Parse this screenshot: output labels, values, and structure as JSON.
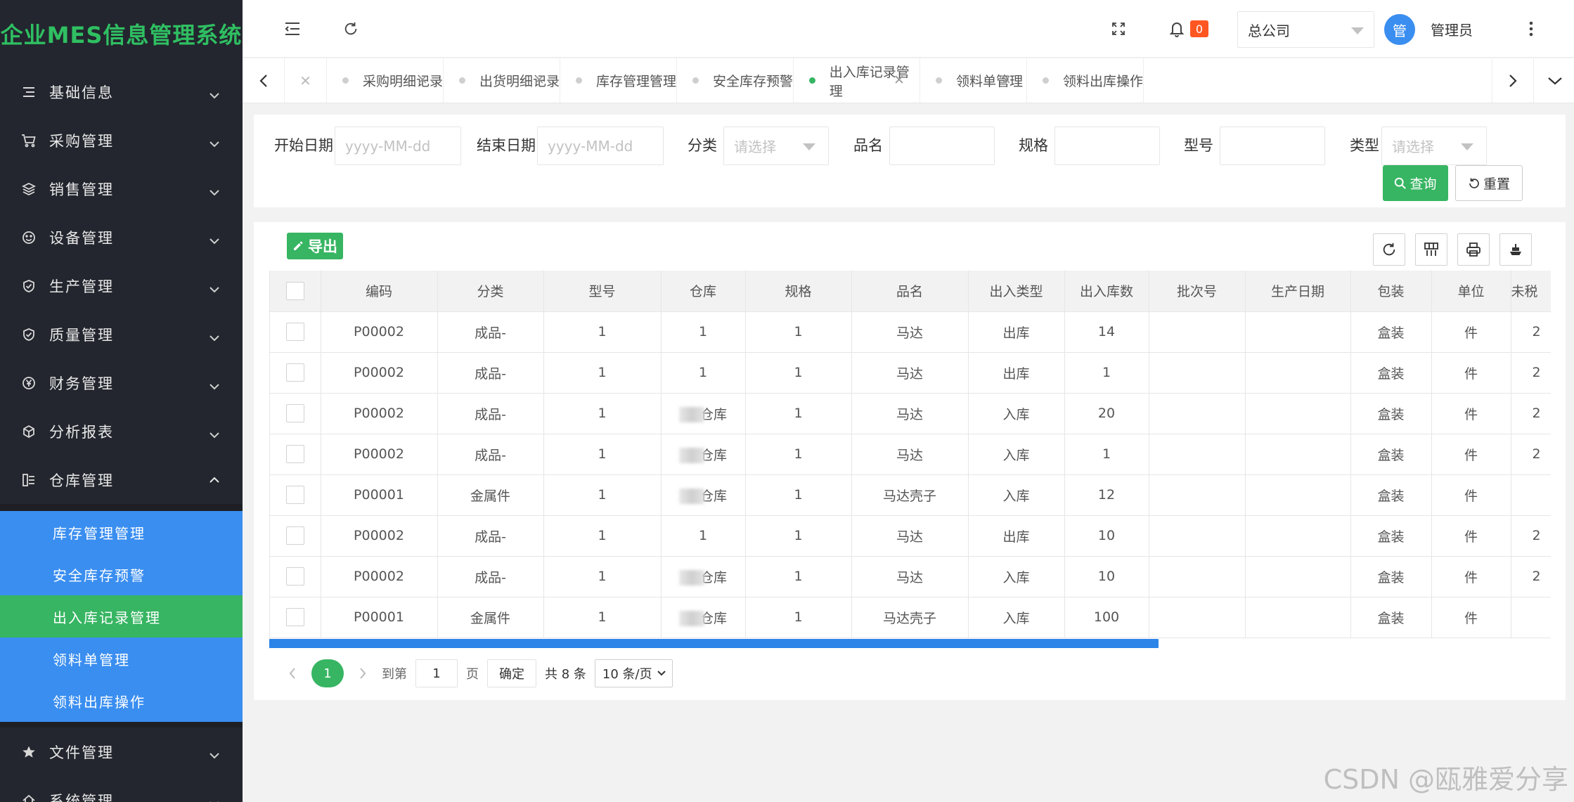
{
  "app": {
    "title": "企业MES信息管理系统"
  },
  "sidebar": {
    "items": [
      {
        "label": "基础信息",
        "icon": "list-icon"
      },
      {
        "label": "采购管理",
        "icon": "cart-icon"
      },
      {
        "label": "销售管理",
        "icon": "layers-icon"
      },
      {
        "label": "设备管理",
        "icon": "smile-icon"
      },
      {
        "label": "生产管理",
        "icon": "shield-check-icon"
      },
      {
        "label": "质量管理",
        "icon": "shield-check-icon"
      },
      {
        "label": "财务管理",
        "icon": "yen-icon"
      },
      {
        "label": "分析报表",
        "icon": "cube-icon"
      },
      {
        "label": "仓库管理",
        "icon": "warehouse-icon",
        "expanded": true
      }
    ],
    "submenu": [
      {
        "label": "库存管理管理",
        "active": false
      },
      {
        "label": "安全库存预警",
        "active": false
      },
      {
        "label": "出入库记录管理",
        "active": true
      },
      {
        "label": "领料单管理",
        "active": false
      },
      {
        "label": "领料出库操作",
        "active": false
      }
    ],
    "items_after": [
      {
        "label": "文件管理",
        "icon": "star-icon"
      },
      {
        "label": "系统管理",
        "icon": "home-icon"
      }
    ]
  },
  "header": {
    "notification_count": "0",
    "company": "总公司",
    "avatar_text": "管",
    "username": "管理员"
  },
  "tabs": [
    {
      "label": "采购明细记录",
      "active": false
    },
    {
      "label": "出货明细记录",
      "active": false
    },
    {
      "label": "库存管理管理",
      "active": false
    },
    {
      "label": "安全库存预警",
      "active": false
    },
    {
      "label": "出入库记录管理",
      "active": true
    },
    {
      "label": "领料单管理",
      "active": false
    },
    {
      "label": "领料出库操作",
      "active": false
    }
  ],
  "filters": {
    "start_date": {
      "label": "开始日期",
      "placeholder": "yyyy-MM-dd"
    },
    "end_date": {
      "label": "结束日期",
      "placeholder": "yyyy-MM-dd"
    },
    "category": {
      "label": "分类",
      "placeholder": "请选择"
    },
    "name": {
      "label": "品名",
      "value": ""
    },
    "spec": {
      "label": "规格",
      "value": ""
    },
    "model": {
      "label": "型号",
      "value": ""
    },
    "type": {
      "label": "类型",
      "placeholder": "请选择"
    },
    "query_label": "查询",
    "reset_label": "重置"
  },
  "toolbar": {
    "export_label": "导出"
  },
  "table": {
    "columns": [
      "编码",
      "分类",
      "型号",
      "仓库",
      "规格",
      "品名",
      "出入类型",
      "出入库数",
      "批次号",
      "生产日期",
      "包装",
      "单位",
      "未税"
    ],
    "rows": [
      [
        "P00002",
        "成品-",
        "1",
        "1",
        "1",
        "马达",
        "出库",
        "14",
        "",
        "",
        "盒装",
        "件",
        "2"
      ],
      [
        "P00002",
        "成品-",
        "1",
        "1",
        "1",
        "马达",
        "出库",
        "1",
        "",
        "",
        "盒装",
        "件",
        "2"
      ],
      [
        "P00002",
        "成品-",
        "1",
        "仓库",
        "1",
        "马达",
        "入库",
        "20",
        "",
        "",
        "盒装",
        "件",
        "2"
      ],
      [
        "P00002",
        "成品-",
        "1",
        "仓库",
        "1",
        "马达",
        "入库",
        "1",
        "",
        "",
        "盒装",
        "件",
        "2"
      ],
      [
        "P00001",
        "金属件",
        "1",
        "仓库",
        "1",
        "马达壳子",
        "入库",
        "12",
        "",
        "",
        "盒装",
        "件",
        ""
      ],
      [
        "P00002",
        "成品-",
        "1",
        "1",
        "1",
        "马达",
        "出库",
        "10",
        "",
        "",
        "盒装",
        "件",
        "2"
      ],
      [
        "P00002",
        "成品-",
        "1",
        "仓库",
        "1",
        "马达",
        "入库",
        "10",
        "",
        "",
        "盒装",
        "件",
        "2"
      ],
      [
        "P00001",
        "金属件",
        "1",
        "仓库",
        "1",
        "马达壳子",
        "入库",
        "100",
        "",
        "",
        "盒装",
        "件",
        ""
      ]
    ],
    "blurred_warehouse_rows": [
      2,
      3,
      4,
      6,
      7
    ]
  },
  "pagination": {
    "current": "1",
    "goto_label": "到第",
    "goto_value": "1",
    "page_unit": "页",
    "confirm_label": "确定",
    "total_text": "共 8 条",
    "page_size": "10 条/页"
  },
  "watermark": "CSDN @瓯雅爱分享",
  "colors": {
    "sidebar_bg": "#23262e",
    "primary_green": "#37b562",
    "primary_blue": "#3a8ef0",
    "badge": "#ff5722"
  }
}
